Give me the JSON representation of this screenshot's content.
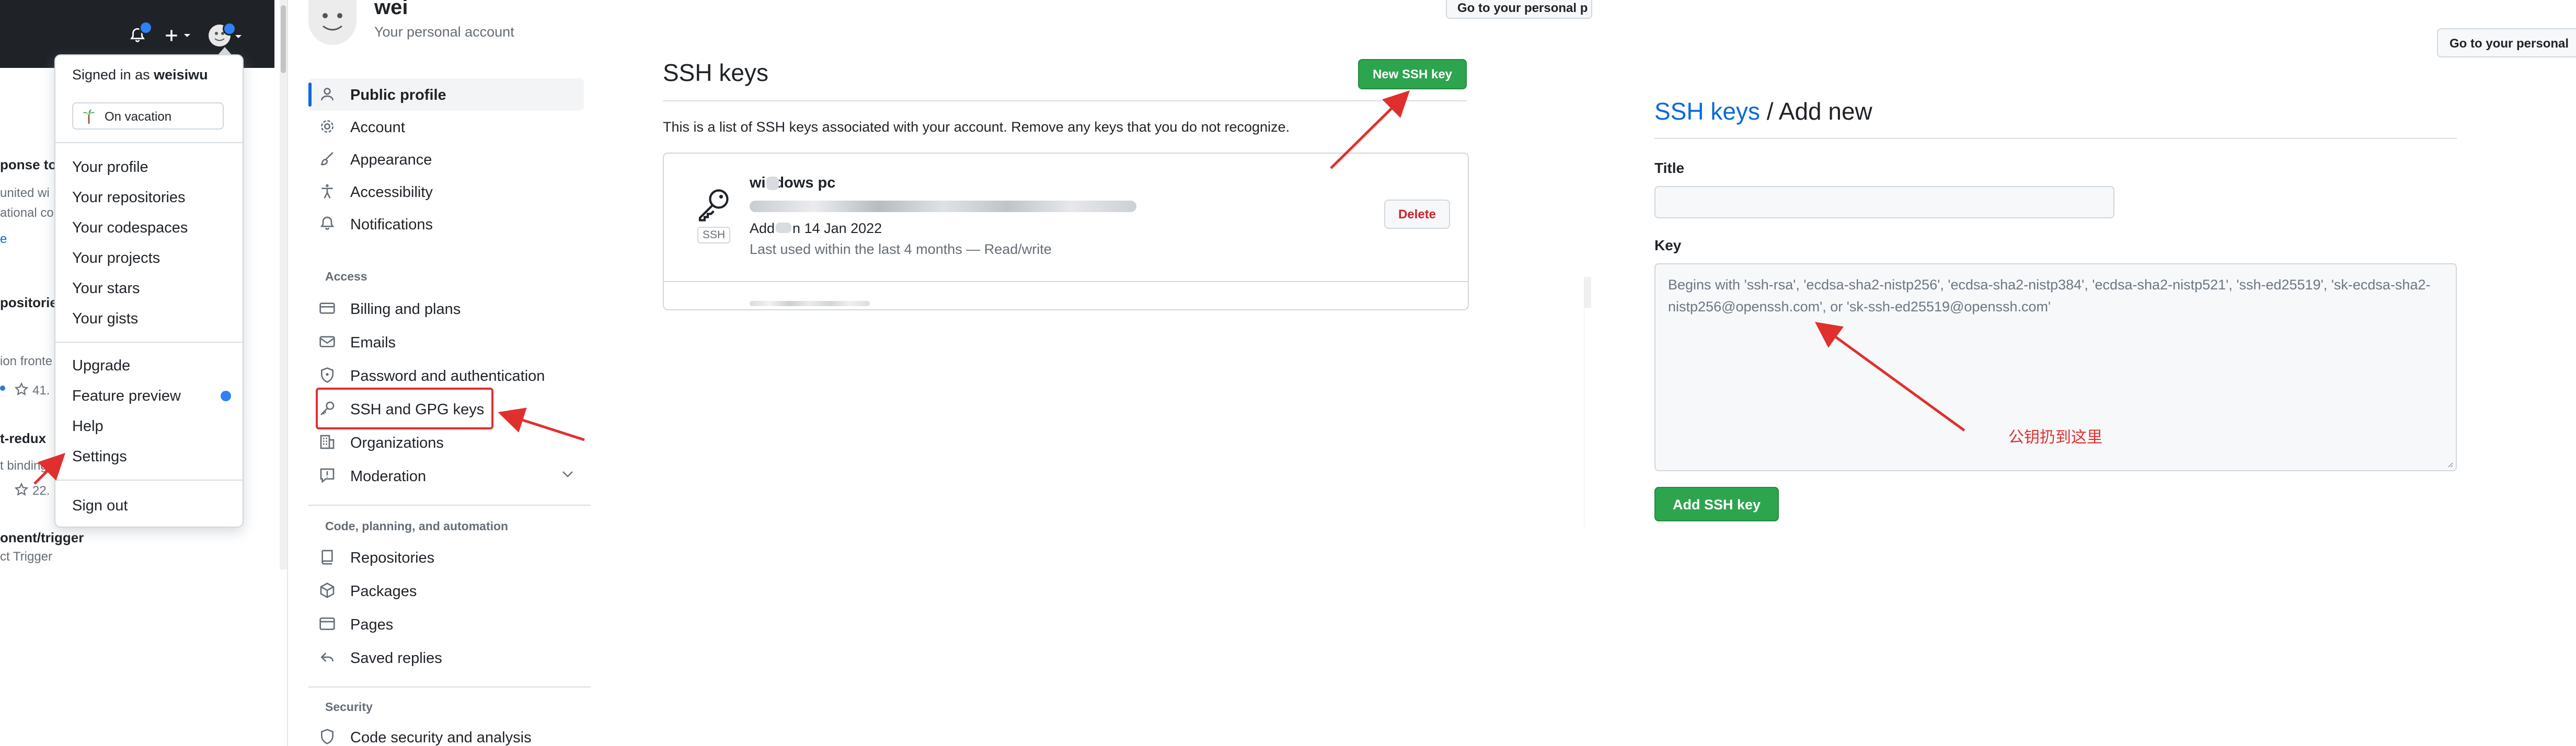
{
  "colors": {
    "accent_blue": "#0969da",
    "primary_green": "#2da44e",
    "danger_red": "#cf222e",
    "annotation_red": "#e0302e",
    "header_dark": "#1f2328"
  },
  "panel_dropdown": {
    "background_list": {
      "items": [
        "ponse to",
        "united wi",
        "ational co",
        "e",
        "positorie",
        "ion fronte",
        "41.",
        "t-redux",
        "t binding",
        "22.",
        "onent/trigger",
        "ct Trigger"
      ],
      "star_icon": "star-icon"
    },
    "header": {
      "icons": [
        "bell-icon",
        "plus-icon",
        "chevron-down-icon",
        "avatar",
        "chevron-down-icon"
      ]
    },
    "menu": {
      "signed_in_prefix": "Signed in as ",
      "username": "weisiwu",
      "status_label": "On vacation",
      "status_icon": "palm-tree-icon",
      "group1": [
        "Your profile",
        "Your repositories",
        "Your codespaces",
        "Your projects",
        "Your stars",
        "Your gists"
      ],
      "group2": [
        "Upgrade",
        "Feature preview",
        "Help",
        "Settings"
      ],
      "sign_out": "Sign out"
    }
  },
  "panel_sidebar": {
    "user_name": "wei",
    "user_subtitle": "Your personal account",
    "items_top": [
      "Public profile",
      "Account",
      "Appearance",
      "Accessibility",
      "Notifications"
    ],
    "access_heading": "Access",
    "items_access": [
      "Billing and plans",
      "Emails",
      "Password and authentication",
      "SSH and GPG keys",
      "Organizations",
      "Moderation"
    ],
    "code_heading": "Code, planning, and automation",
    "items_code": [
      "Repositories",
      "Packages",
      "Pages",
      "Saved replies"
    ],
    "security_heading": "Security",
    "items_security": [
      "Code security and analysis"
    ]
  },
  "panel_keys": {
    "personal_btn": "Go to your personal p",
    "title": "SSH keys",
    "new_button": "New SSH key",
    "description": "This is a list of SSH keys associated with your account. Remove any keys that you do not recognize.",
    "key": {
      "name": "windows pc",
      "badge": "SSH",
      "added_prefix": "Add",
      "added_mid": "n 14 Jan 2022",
      "last_used": "Last used within the last 4 months — Read/write",
      "delete_button": "Delete"
    }
  },
  "panel_add": {
    "personal_btn": "Go to your personal",
    "breadcrumb_link": "SSH keys",
    "breadcrumb_rest": " / Add new",
    "title_label": "Title",
    "title_value": "",
    "key_label": "Key",
    "key_placeholder": "Begins with 'ssh-rsa', 'ecdsa-sha2-nistp256', 'ecdsa-sha2-nistp384', 'ecdsa-sha2-nistp521', 'ssh-ed25519', 'sk-ecdsa-sha2-nistp256@openssh.com', or 'sk-ssh-ed25519@openssh.com'",
    "annotation": "公钥扔到这里",
    "submit_button": "Add SSH key"
  }
}
